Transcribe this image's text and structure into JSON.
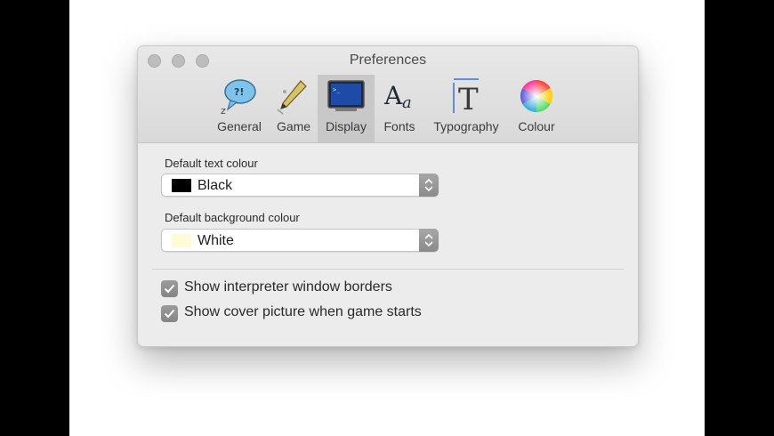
{
  "window": {
    "title": "Preferences"
  },
  "toolbar": {
    "tabs": [
      {
        "label": "General",
        "icon": "speech-bubble-icon"
      },
      {
        "label": "Game",
        "icon": "pen-icon"
      },
      {
        "label": "Display",
        "icon": "monitor-icon",
        "selected": true
      },
      {
        "label": "Fonts",
        "icon": "font-aa-icon"
      },
      {
        "label": "Typography",
        "icon": "typography-t-icon"
      },
      {
        "label": "Colour",
        "icon": "color-wheel-icon"
      }
    ]
  },
  "display": {
    "text_colour_label": "Default text colour",
    "text_colour_value": "Black",
    "text_colour_swatch": "#000000",
    "background_colour_label": "Default background colour",
    "background_colour_value": "White",
    "background_colour_swatch": "#fffbd6",
    "show_borders_label": "Show interpreter window borders",
    "show_borders_checked": true,
    "show_cover_label": "Show cover picture when game starts",
    "show_cover_checked": true
  }
}
